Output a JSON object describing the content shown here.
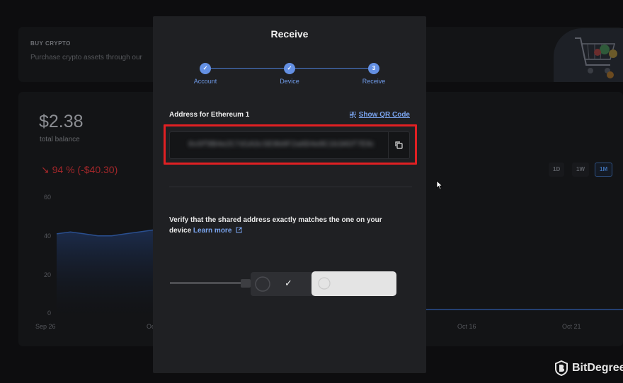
{
  "background": {
    "buy_crypto": {
      "title": "BUY CRYPTO",
      "subtitle": "Purchase crypto assets through our"
    },
    "portfolio": {
      "balance": "$2.38",
      "balance_label": "total balance",
      "change": "↘ 94 % (-$40.30)",
      "ranges": [
        "1D",
        "1W",
        "1M"
      ],
      "active_range": "1M"
    }
  },
  "chart_data": {
    "type": "area",
    "x_ticks": [
      "Sep 26",
      "Oc",
      "Oct 16",
      "Oct 21"
    ],
    "y_ticks": [
      "60",
      "40",
      "20",
      "0"
    ],
    "ylim": [
      0,
      60
    ],
    "series": [
      {
        "values": [
          41,
          42,
          41,
          40,
          40,
          41,
          42,
          43
        ]
      }
    ]
  },
  "modal": {
    "title": "Receive",
    "steps": [
      {
        "label": "Account",
        "marker": "✓"
      },
      {
        "label": "Device",
        "marker": "✓"
      },
      {
        "label": "Receive",
        "marker": "3"
      }
    ],
    "address_label": "Address for Ethereum 1",
    "show_qr_label": "Show QR Code",
    "address_value": "0x9f8B4e2C7d1A3c5E9b0F2a6D4e8C1b3A5f7E9d2C",
    "verify_text": "Verify that the shared address exactly matches the one on your device",
    "learn_more": "Learn more",
    "device_check": "✓"
  },
  "brand": {
    "name": "BitDegree"
  },
  "colors": {
    "accent": "#6490e3",
    "highlight": "#e02023",
    "negative": "#a3272a"
  }
}
